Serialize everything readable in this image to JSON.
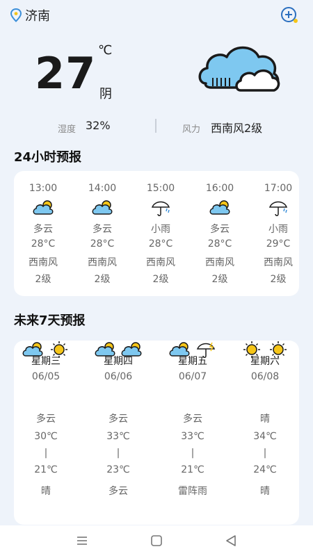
{
  "header": {
    "city": "济南"
  },
  "current": {
    "temp": "27",
    "unit": "℃",
    "weather": "阴",
    "humidity_label": "湿度",
    "humidity_value": "32%",
    "wind_label": "风力",
    "wind_value": "西南风2级"
  },
  "hourly": {
    "title": "24小时预报",
    "items": [
      {
        "time": "13:00",
        "icon": "partly-cloudy-icon",
        "weather": "多云",
        "temp": "28°C",
        "wind_dir": "西南风",
        "wind_level": "2级"
      },
      {
        "time": "14:00",
        "icon": "partly-cloudy-icon",
        "weather": "多云",
        "temp": "28°C",
        "wind_dir": "西南风",
        "wind_level": "2级"
      },
      {
        "time": "15:00",
        "icon": "light-rain-icon",
        "weather": "小雨",
        "temp": "28°C",
        "wind_dir": "西南风",
        "wind_level": "2级"
      },
      {
        "time": "16:00",
        "icon": "partly-cloudy-icon",
        "weather": "多云",
        "temp": "28°C",
        "wind_dir": "西南风",
        "wind_level": "2级"
      },
      {
        "time": "17:00",
        "icon": "light-rain-icon",
        "weather": "小雨",
        "temp": "29°C",
        "wind_dir": "西南风",
        "wind_level": "2级"
      }
    ]
  },
  "daily": {
    "title": "未来7天预报",
    "items": [
      {
        "day": "星期三",
        "date": "06/05",
        "weather_day": "多云",
        "high": "30℃",
        "sep": "|",
        "low": "21℃",
        "weather_night": "晴",
        "icon_day": "partly-cloudy-icon",
        "icon_night": "sun-icon"
      },
      {
        "day": "星期四",
        "date": "06/06",
        "weather_day": "多云",
        "high": "33℃",
        "sep": "|",
        "low": "23℃",
        "weather_night": "多云",
        "icon_day": "partly-cloudy-icon",
        "icon_night": "partly-cloudy-icon"
      },
      {
        "day": "星期五",
        "date": "06/07",
        "weather_day": "多云",
        "high": "33℃",
        "sep": "|",
        "low": "21℃",
        "weather_night": "雷阵雨",
        "icon_day": "partly-cloudy-icon",
        "icon_night": "thunderstorm-icon"
      },
      {
        "day": "星期六",
        "date": "06/08",
        "weather_day": "晴",
        "high": "34℃",
        "sep": "|",
        "low": "24℃",
        "weather_night": "晴",
        "icon_day": "sun-icon",
        "icon_night": "sun-icon"
      }
    ]
  },
  "colors": {
    "background": "#eef3fa",
    "card": "#ffffff",
    "cloud_blue": "#7ec8f0",
    "sun_yellow": "#f5c518",
    "text_muted": "#666666"
  }
}
